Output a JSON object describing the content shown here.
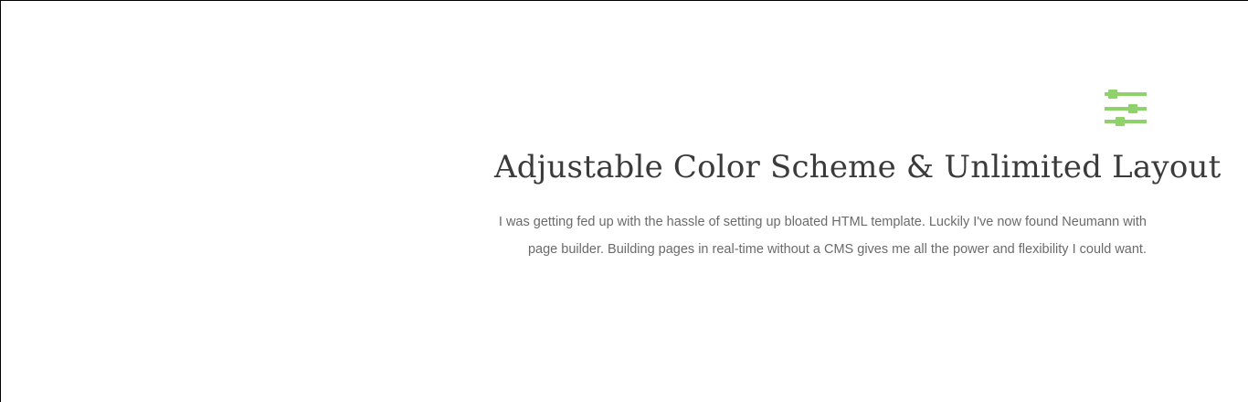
{
  "feature": {
    "icon": "sliders-icon",
    "title": "Adjustable Color Scheme & Unlimited Layout",
    "description": "I was getting fed up with the hassle of setting up bloated HTML template. Luckily I've now found Neumann with page builder. Building pages in real-time without a CMS gives me all the power and flexibility I could want."
  },
  "colors": {
    "accent": "#8fd16a",
    "heading": "#3b3b3b",
    "body_text": "#6b6b6b",
    "background": "#ffffff"
  }
}
